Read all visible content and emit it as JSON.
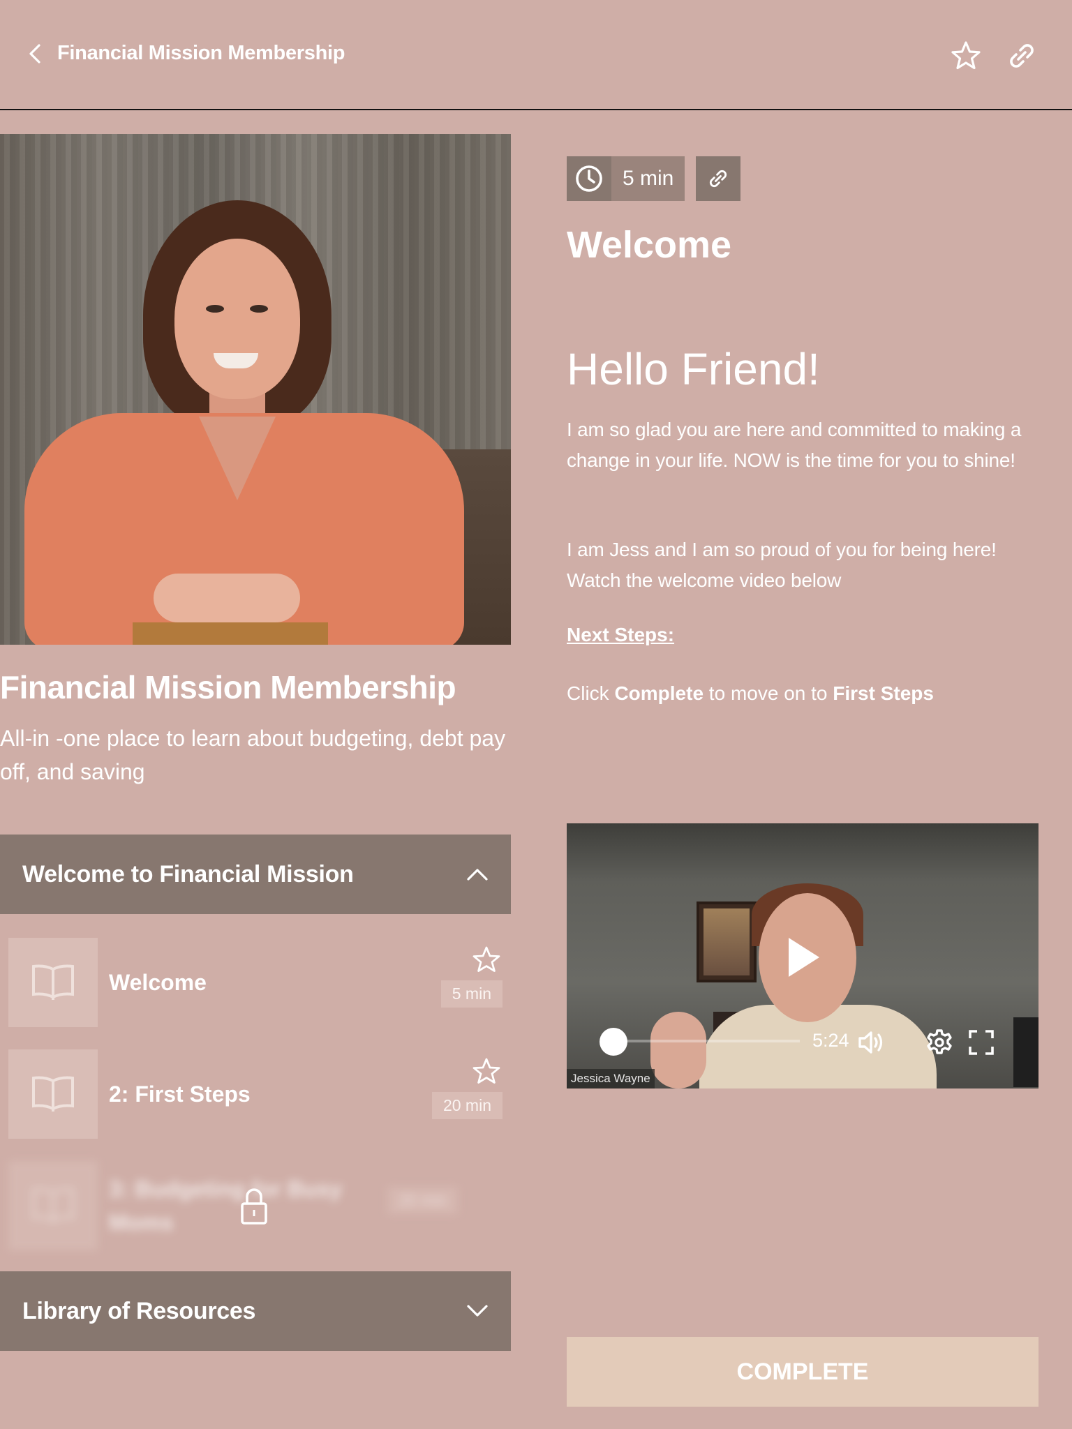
{
  "header": {
    "back_icon": "chevron-left-icon",
    "title": "Financial Mission Membership",
    "favorite_icon": "star-icon",
    "share_icon": "link-icon"
  },
  "course": {
    "hero_image": "instructor-portrait",
    "title": "Financial Mission Membership",
    "description": "All-in -one place to learn about budgeting, debt pay off, and saving"
  },
  "sections": [
    {
      "title": "Welcome to Financial Mission",
      "expanded": true,
      "toggle_icon": "chevron-up-icon",
      "lessons": [
        {
          "title": "Welcome",
          "duration": "5 min",
          "locked": false,
          "icon": "book-open-icon"
        },
        {
          "title": "2: First Steps",
          "duration": "20 min",
          "locked": false,
          "icon": "book-open-icon"
        },
        {
          "title": "3: Budgeting for Busy Moms",
          "duration": "20 min",
          "locked": true,
          "icon": "book-open-icon"
        }
      ]
    },
    {
      "title": "Library of Resources",
      "expanded": false,
      "toggle_icon": "chevron-down-icon"
    }
  ],
  "lesson": {
    "duration": "5 min",
    "title": "Welcome",
    "heading": "Hello Friend!",
    "paragraph1": "I am so glad you are here and committed to making a change in your life. NOW is the time for you to shine!",
    "paragraph2": "I am Jess and I am so proud of you for being here! Watch the welcome video below",
    "next_steps_label": "Next Steps:",
    "click_prefix": "Click ",
    "click_bold1": "Complete",
    "click_middle": " to move on to ",
    "click_bold2": "First Steps"
  },
  "video": {
    "duration": "5:24",
    "progress_percent": 0,
    "credit": "Jessica Wayne"
  },
  "complete_button": "COMPLETE",
  "colors": {
    "background": "#cfaea7",
    "section_header": "#87776f",
    "chip": "#9a847c",
    "complete_button": "#e3cbb9"
  }
}
